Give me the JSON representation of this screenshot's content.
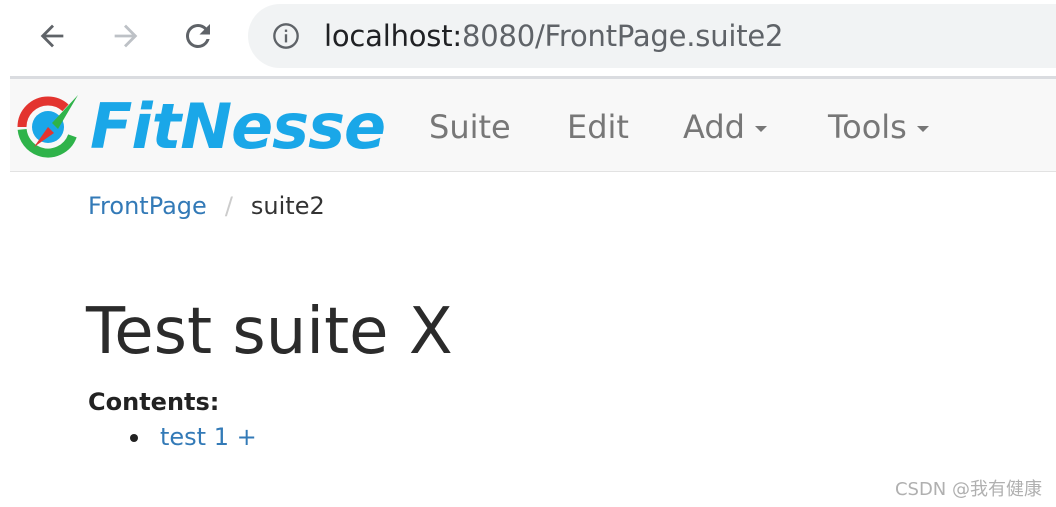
{
  "browser": {
    "url_host": "localhost:",
    "url_rest": "8080/FrontPage.suite2",
    "icons": {
      "back": "arrow-left-icon",
      "forward": "arrow-right-icon",
      "reload": "reload-icon",
      "site_info": "info-icon"
    }
  },
  "navbar": {
    "logo_text": "FitNesse",
    "items": [
      {
        "label": "Suite",
        "dropdown": false
      },
      {
        "label": "Edit",
        "dropdown": false
      },
      {
        "label": "Add",
        "dropdown": true
      },
      {
        "label": "Tools",
        "dropdown": true
      }
    ]
  },
  "breadcrumb": {
    "parent": "FrontPage",
    "separator": "/",
    "current": "suite2"
  },
  "page": {
    "title": "Test suite X",
    "contents_label": "Contents:",
    "contents_items": [
      "test 1 +"
    ]
  },
  "watermark": "CSDN @我有健康",
  "colors": {
    "link": "#337ab7",
    "logo_blue": "#1aa7e8",
    "nav_text": "#777777",
    "navbar_bg": "#f8f8f8"
  }
}
